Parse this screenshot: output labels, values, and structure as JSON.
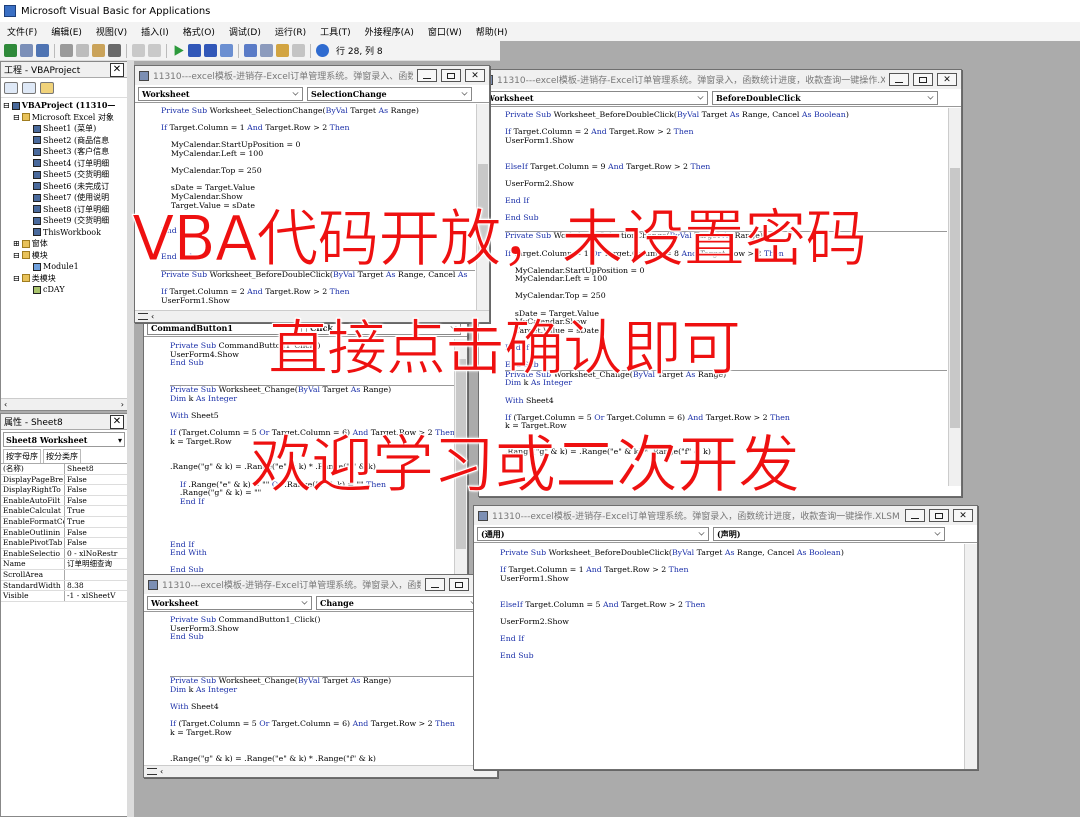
{
  "app": {
    "title": "Microsoft Visual Basic for Applications"
  },
  "menu": [
    "文件(F)",
    "编辑(E)",
    "视图(V)",
    "插入(I)",
    "格式(O)",
    "调试(D)",
    "运行(R)",
    "工具(T)",
    "外接程序(A)",
    "窗口(W)",
    "帮助(H)"
  ],
  "toolbar": {
    "cursor_pos": "行 28, 列 8"
  },
  "project": {
    "title": "工程 - VBAProject",
    "root": "VBAProject (11310—",
    "folder_objects": "Microsoft Excel 对象",
    "sheets": [
      "Sheet1 (菜单)",
      "Sheet2 (商品信息",
      "Sheet3 (客户信息",
      "Sheet4 (订单明细",
      "Sheet5 (交货明细",
      "Sheet6 (未完成订",
      "Sheet7 (使用说明",
      "Sheet8 (订单明细",
      "Sheet9 (交货明细",
      "ThisWorkbook"
    ],
    "folder_forms": "窗体",
    "folder_modules": "模块",
    "module1": "Module1",
    "folder_classes": "类模块",
    "class1": "cDAY"
  },
  "properties": {
    "title": "属性 - Sheet8",
    "object": "Sheet8 Worksheet",
    "tab_alpha": "按字母序",
    "tab_category": "按分类序",
    "rows": [
      [
        "(名称)",
        "Sheet8"
      ],
      [
        "DisplayPageBre",
        "False"
      ],
      [
        "DisplayRightTo",
        "False"
      ],
      [
        "EnableAutoFilt",
        "False"
      ],
      [
        "EnableCalculat",
        "True"
      ],
      [
        "EnableFormatCo",
        "True"
      ],
      [
        "EnableOutlinin",
        "False"
      ],
      [
        "EnablePivotTab",
        "False"
      ],
      [
        "EnableSelectio",
        "0 - xlNoRestr"
      ],
      [
        "Name",
        "订单明细查询"
      ],
      [
        "ScrollArea",
        ""
      ],
      [
        "StandardWidth",
        "8.38"
      ],
      [
        "Visible",
        "-1 - xlSheetV"
      ]
    ]
  },
  "windows": {
    "w1": {
      "title": "11310---excel模板-进销存-Excel订单管理系统。弹窗录入、函数...",
      "object": "Worksheet",
      "proc": "SelectionChange",
      "code": [
        "Private Sub Worksheet_SelectionChange(ByVal Target As Range)",
        "",
        "If Target.Column = 1 And Target.Row > 2 Then",
        "",
        "    MyCalendar.StartUpPosition = 0",
        "    MyCalendar.Left = 100",
        "",
        "    MyCalendar.Top = 250",
        "",
        "    sDate = Target.Value",
        "    MyCalendar.Show",
        "    Target.Value = sDate",
        "",
        "",
        "End If",
        "",
        "",
        "End Sub",
        "",
        "Private Sub Worksheet_BeforeDoubleClick(ByVal Target As Range, Cancel As",
        "",
        "If Target.Column = 2 And Target.Row > 2 Then",
        "UserForm1.Show"
      ]
    },
    "w2": {
      "object": "CommandButton1",
      "proc": "Click",
      "code": [
        "Private Sub CommandButton1_Click()",
        "UserForm4.Show",
        "End Sub",
        "",
        "",
        "Private Sub Worksheet_Change(ByVal Target As Range)",
        "Dim k As Integer",
        "",
        "With Sheet5",
        "",
        "If (Target.Column = 5 Or Target.Column = 6) And Target.Row > 2 Then",
        "k = Target.Row",
        "",
        "",
        ".Range(\"g\" & k) = .Range(\"e\" & k) * .Range(\"f\" & k)",
        "",
        "    If .Range(\"e\" & k) = \"\" Or .Range(\"f\" & k) = \"\" Then",
        "    .Range(\"g\" & k) = \"\"",
        "    End If",
        "",
        "",
        "",
        "",
        "End If",
        "End With",
        "",
        "End Sub"
      ]
    },
    "w3": {
      "title": "11310---excel模板-进销存-Excel订单管理系统。弹窗录入，函数统计进度，收款查询一键操作.XL...",
      "object": "Worksheet",
      "proc": "BeforeDoubleClick",
      "code": [
        "Private Sub Worksheet_BeforeDoubleClick(ByVal Target As Range, Cancel As Boolean)",
        "",
        "If Target.Column = 2 And Target.Row > 2 Then",
        "UserForm1.Show",
        "",
        "",
        "ElseIf Target.Column = 9 And Target.Row > 2 Then",
        "",
        "UserForm2.Show",
        "",
        "End If",
        "",
        "End Sub",
        "",
        "Private Sub Worksheet_SelectionChange(ByVal Target As Range)",
        "",
        "If Target.Column = 1 Or Target.Column = 8 And Target.Row > 2 Then",
        "",
        "    MyCalendar.StartUpPosition = 0",
        "    MyCalendar.Left = 100",
        "",
        "    MyCalendar.Top = 250",
        "",
        "    sDate = Target.Value",
        "    MyCalendar.Show",
        "    Target.Value = sDate",
        "",
        "End If",
        "",
        "End Sub",
        "Private Sub Worksheet_Change(ByVal Target As Range)",
        "Dim k As Integer",
        "",
        "With Sheet4",
        "",
        "If (Target.Column = 5 Or Target.Column = 6) And Target.Row > 2 Then",
        "k = Target.Row",
        "",
        "",
        ".Range(\"g\" & k) = .Range(\"e\" & k) * .Range(\"f\" & k)"
      ]
    },
    "w4": {
      "title": "11310---excel模板-进销存-Excel订单管理系统。弹窗录入，函数...",
      "object": "Worksheet",
      "proc": "Change",
      "code": [
        "Private Sub CommandButton1_Click()",
        "UserForm3.Show",
        "End Sub",
        "",
        "",
        "",
        "",
        "Private Sub Worksheet_Change(ByVal Target As Range)",
        "Dim k As Integer",
        "",
        "With Sheet4",
        "",
        "If (Target.Column = 5 Or Target.Column = 6) And Target.Row > 2 Then",
        "k = Target.Row",
        "",
        "",
        ".Range(\"g\" & k) = .Range(\"e\" & k) * .Range(\"f\" & k)"
      ]
    },
    "w5": {
      "title": "11310---excel模板-进销存-Excel订单管理系统。弹窗录入，函数统计进度，收款查询一键操作.XLSM - ...",
      "object": "(通用)",
      "proc": "(声明)",
      "code": [
        "Private Sub Worksheet_BeforeDoubleClick(ByVal Target As Range, Cancel As Boolean)",
        "",
        "If Target.Column = 1 And Target.Row > 2 Then",
        "UserForm1.Show",
        "",
        "",
        "ElseIf Target.Column = 5 And Target.Row > 2 Then",
        "",
        "UserForm2.Show",
        "",
        "End If",
        "",
        "End Sub"
      ]
    }
  },
  "overlay": {
    "line1": "VBA代码开放，未设置密码",
    "line2": "直接点击确认即可",
    "line3": "欢迎学习或二次开发",
    "color": "#ee1010"
  }
}
